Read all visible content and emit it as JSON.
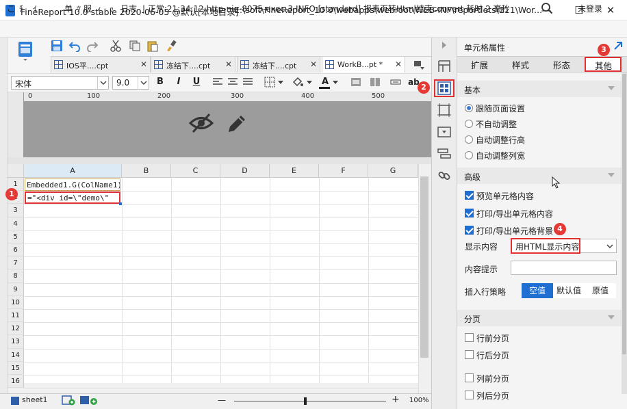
{
  "window": {
    "title": "FineReport 10.0 stable 2020-06-05 @默认[本地目录]",
    "path": "E:\\soft\\FineReport_10.0\\webapps\\webroot\\WEB-INF\\reportlets\\111\\Wor...",
    "minimize": "—",
    "maximize": "☐",
    "close": "✕"
  },
  "menubar": {
    "items": [
      "こ",
      "ﾁ",
      "ｲ",
      "单",
      "ﾂ",
      "服",
      "ｨ",
      "ｯ",
      "日志"
    ],
    "log": "| 正常:21:34:12 http-nio-8075-exec-3 INFO [standard] 报表页转Html结束convert  耗时 2 毫秒",
    "login": "未登录"
  },
  "tabs": [
    {
      "label": "IOS平....cpt"
    },
    {
      "label": "冻结下....cpt"
    },
    {
      "label": "冻结下....cpt"
    },
    {
      "label": "WorkB...pt *"
    }
  ],
  "format": {
    "font": "宋体",
    "size": "9.0",
    "bold": "B",
    "italic": "I",
    "underline": "U",
    "fontcolor": "A",
    "ab": "ab"
  },
  "ruler": [
    "0",
    "100",
    "200",
    "300",
    "400",
    "500"
  ],
  "sheet": {
    "columns": [
      "A",
      "B",
      "C",
      "D",
      "E",
      "F",
      "G"
    ],
    "rows": [
      "1",
      "2",
      "3",
      "4",
      "5",
      "6",
      "7",
      "8",
      "9",
      "10",
      "11",
      "12",
      "13",
      "14",
      "15",
      "16"
    ],
    "a1": "Embedded1.G(ColName1)",
    "a2": "=\"<div id=\\\"demo\\\"",
    "sheet_tab": "sheet1",
    "zoom": "100%",
    "zoom_fraction": 0.47,
    "minus": "—",
    "plus": "+"
  },
  "badges": {
    "b1": "1",
    "b2": "2",
    "b3": "3",
    "b4": "4"
  },
  "panel": {
    "title": "单元格属性",
    "tabs": [
      "扩展",
      "样式",
      "形态",
      "其他"
    ],
    "basic": {
      "header": "基本",
      "options": [
        "跟随页面设置",
        "不自动调整",
        "自动调整行高",
        "自动调整列宽"
      ]
    },
    "advanced": {
      "header": "高级",
      "checks": [
        "预览单元格内容",
        "打印/导出单元格内容",
        "打印/导出单元格背景"
      ],
      "display_label": "显示内容",
      "display_value": "用HTML显示内容",
      "tooltip_label": "内容提示",
      "insert_label": "插入行策略",
      "insert_options": [
        "空值",
        "默认值",
        "原值"
      ]
    },
    "paging": {
      "header": "分页",
      "checks": [
        "行前分页",
        "行后分页",
        "列前分页",
        "列后分页"
      ]
    }
  },
  "colors": {
    "accent": "#1e6fd1",
    "badge": "#e53935"
  }
}
